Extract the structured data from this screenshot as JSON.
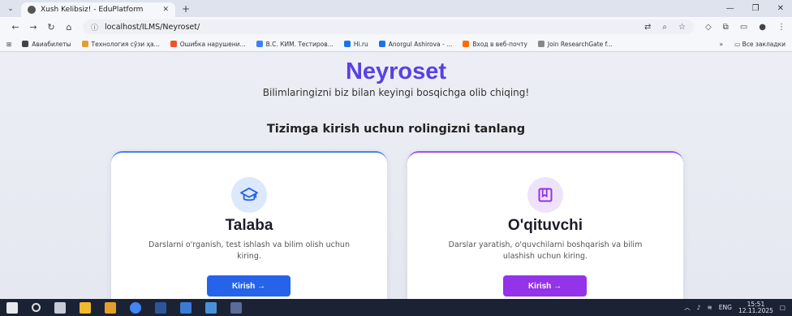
{
  "browser": {
    "tab_title": "Xush Kelibsiz! - EduPlatform",
    "tab_close": "✕",
    "new_tab": "+",
    "url": "localhost/ILMS/Neyroset/",
    "bookmarks": [
      {
        "label": "Авиабилеты",
        "color": "#444444"
      },
      {
        "label": "Технология сўзи ҳа...",
        "color": "#e0a030"
      },
      {
        "label": "Ошибка нарушени...",
        "color": "#f25022"
      },
      {
        "label": "B.C. КИМ. Тестиров...",
        "color": "#3b82f6"
      },
      {
        "label": "Hi.ru",
        "color": "#1a73e8"
      },
      {
        "label": "Anorgul Ashirova - ...",
        "color": "#1a73e8"
      },
      {
        "label": "Вход в веб-почту",
        "color": "#ff6a00"
      },
      {
        "label": "Join ResearchGate f...",
        "color": "#888888"
      }
    ],
    "bookmarks_more": "»",
    "all_bookmarks": "Все закладки"
  },
  "page": {
    "brand": "Neyroset",
    "tagline": "Bilimlaringizni biz bilan keyingi bosqichga olib chiqing!",
    "prompt": "Tizimga kirish uchun rolingizni tanlang",
    "roles": [
      {
        "title": "Talaba",
        "description": "Darslarni o'rganish, test ishlash va bilim olish uchun kiring.",
        "button": "Kirish →",
        "icon": "graduation-cap-icon",
        "accent": "#2563eb"
      },
      {
        "title": "O'qituvchi",
        "description": "Darslar yaratish, o'quvchilarni boshqarish va bilim ulashish uchun kiring.",
        "button": "Kirish →",
        "icon": "book-icon",
        "accent": "#9333ea"
      }
    ]
  },
  "taskbar": {
    "language": "ENG",
    "time": "15:51",
    "date": "12.11.2025"
  }
}
